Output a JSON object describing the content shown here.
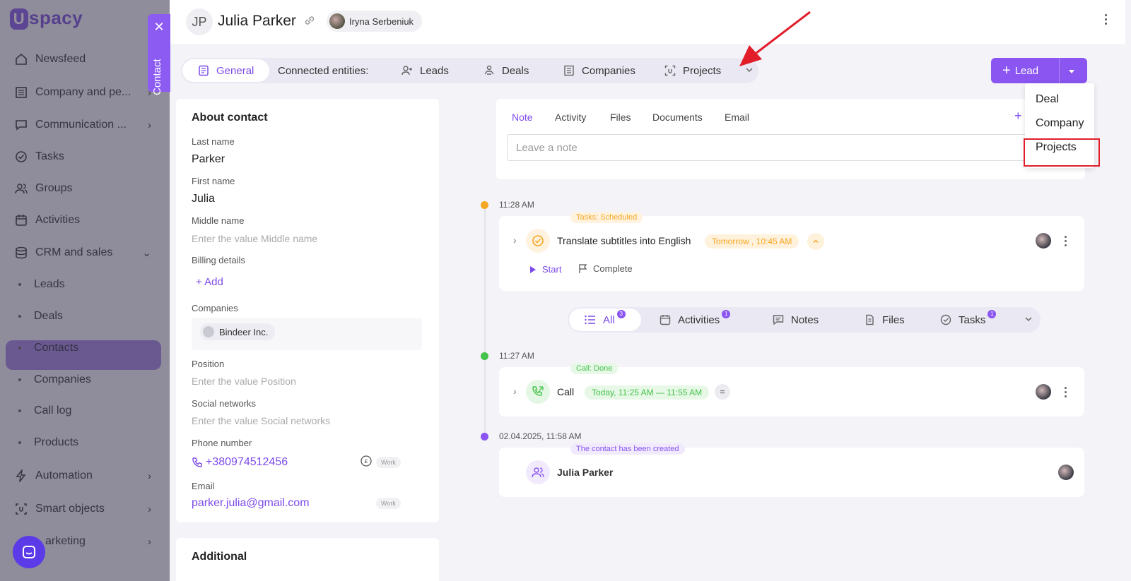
{
  "sidebar": {
    "logo": "spacy",
    "items": [
      {
        "label": "Newsfeed",
        "icon": "home-icon"
      },
      {
        "label": "Company and pe...",
        "icon": "building-icon"
      },
      {
        "label": "Communication ...",
        "icon": "chat-icon"
      },
      {
        "label": "Tasks",
        "icon": "check-circle-icon"
      },
      {
        "label": "Groups",
        "icon": "group-icon"
      },
      {
        "label": "Activities",
        "icon": "calendar-icon"
      },
      {
        "label": "CRM and sales",
        "icon": "database-icon"
      },
      {
        "label": "Automation",
        "icon": "lightning-icon"
      },
      {
        "label": "Smart objects",
        "icon": "smart-objects-icon"
      },
      {
        "label": "arketing",
        "icon": "marketing-icon"
      }
    ],
    "crm_subitems": [
      "Leads",
      "Deals",
      "Contacts",
      "Companies",
      "Call log",
      "Products"
    ],
    "active_subitem": "Contacts",
    "contact_tab_label": "Contact"
  },
  "header": {
    "initials": "JP",
    "name": "Julia Parker",
    "owner": "Iryna Serbeniuk"
  },
  "tabs": {
    "general": "General",
    "connected": "Connected entities:",
    "leads": "Leads",
    "deals": "Deals",
    "companies": "Companies",
    "projects": "Projects"
  },
  "create_button": {
    "label": "Lead",
    "menu": [
      "Deal",
      "Company",
      "Projects"
    ],
    "highlighted": "Projects"
  },
  "about": {
    "title": "About contact",
    "last_name_label": "Last name",
    "last_name": "Parker",
    "first_name_label": "First name",
    "first_name": "Julia",
    "middle_name_label": "Middle name",
    "middle_name_placeholder": "Enter the value Middle name",
    "billing_label": "Billing details",
    "add_label": "Add",
    "companies_label": "Companies",
    "company": "Bindeer Inc.",
    "position_label": "Position",
    "position_placeholder": "Enter the value Position",
    "social_label": "Social networks",
    "social_placeholder": "Enter the value Social networks",
    "phone_label": "Phone number",
    "phone": "+380974512456",
    "phone_tag": "Work",
    "email_label": "Email",
    "email": "parker.julia@gmail.com",
    "email_tag": "Work",
    "additional_title": "Additional"
  },
  "note_editor": {
    "tabs": [
      "Note",
      "Activity",
      "Files",
      "Documents",
      "Email"
    ],
    "active_tab": "Note",
    "placeholder": "Leave a note"
  },
  "timeline": {
    "task": {
      "time": "11:28 AM",
      "badge": "Tasks: Scheduled",
      "title": "Translate subtitles into English",
      "due": "Tomorrow , 10:45 AM",
      "start_label": "Start",
      "complete_label": "Complete"
    },
    "filters": [
      {
        "label": "All",
        "count": "3"
      },
      {
        "label": "Activities",
        "count": "1"
      },
      {
        "label": "Notes",
        "count": ""
      },
      {
        "label": "Files",
        "count": ""
      },
      {
        "label": "Tasks",
        "count": "1"
      }
    ],
    "call": {
      "time": "11:27 AM",
      "badge": "Call: Done",
      "title": "Call",
      "range": "Today, 11:25 AM — 11:55 AM"
    },
    "created": {
      "time": "02.04.2025, 11:58 AM",
      "badge": "The contact has been created",
      "title": "Julia Parker"
    }
  },
  "colors": {
    "accent": "#8a55f0",
    "task_orange": "#f5a623",
    "call_green": "#44c24a",
    "highlight_red": "#e11d2a"
  }
}
